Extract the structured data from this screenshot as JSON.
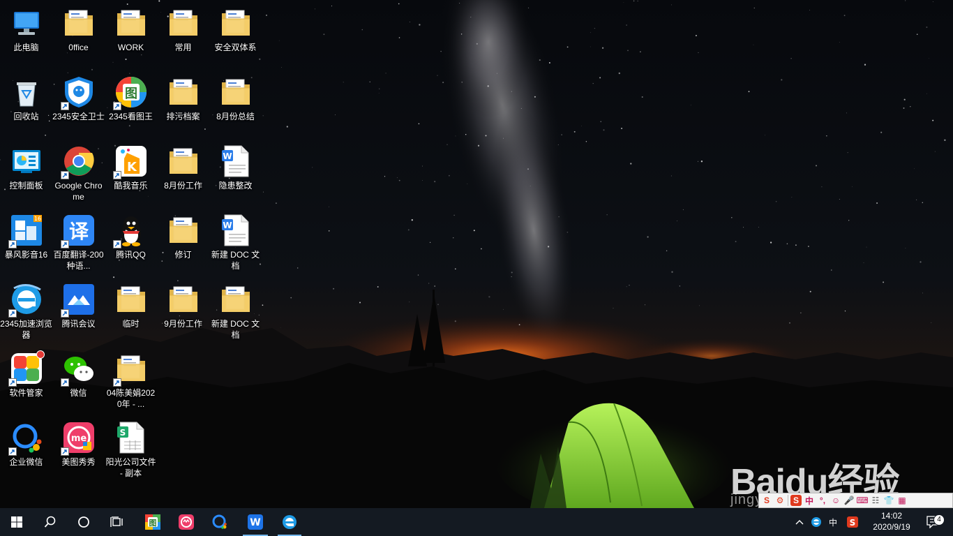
{
  "desktop": {
    "icons": [
      {
        "label": "此电脑",
        "icon": "computer-icon",
        "shortcut": false
      },
      {
        "label": "回收站",
        "icon": "recycle-bin-icon",
        "shortcut": false
      },
      {
        "label": "控制面板",
        "icon": "control-panel-icon",
        "shortcut": false
      },
      {
        "label": "暴风影音16",
        "icon": "baofeng-icon",
        "shortcut": true
      },
      {
        "label": "2345加速浏览器",
        "icon": "ie-browser-icon",
        "shortcut": true
      },
      {
        "label": "软件管家",
        "icon": "software-manager-icon",
        "shortcut": true
      },
      {
        "label": "企业微信",
        "icon": "wecom-icon",
        "shortcut": true
      },
      {
        "label": "0ffice",
        "icon": "folder-icon",
        "shortcut": false
      },
      {
        "label": "2345安全卫士",
        "icon": "shield-icon",
        "shortcut": true
      },
      {
        "label": "Google Chrome",
        "icon": "chrome-icon",
        "shortcut": true
      },
      {
        "label": "百度翻译-200种语...",
        "icon": "baidu-translate-icon",
        "shortcut": true
      },
      {
        "label": "腾讯会议",
        "icon": "tencent-meeting-icon",
        "shortcut": true
      },
      {
        "label": "微信",
        "icon": "wechat-icon",
        "shortcut": true
      },
      {
        "label": "美图秀秀",
        "icon": "meitu-icon",
        "shortcut": true
      },
      {
        "label": "WORK",
        "icon": "folder-icon",
        "shortcut": false
      },
      {
        "label": "2345看图王",
        "icon": "image-viewer-icon",
        "shortcut": true
      },
      {
        "label": "酷我音乐",
        "icon": "kuwo-music-icon",
        "shortcut": true
      },
      {
        "label": "腾讯QQ",
        "icon": "qq-penguin-icon",
        "shortcut": true
      },
      {
        "label": "临时",
        "icon": "folder-icon",
        "shortcut": false
      },
      {
        "label": "04陈美娟2020年 - ...",
        "icon": "folder-icon",
        "shortcut": true
      },
      {
        "label": "阳光公司文件 - 副本",
        "icon": "spreadsheet-icon",
        "shortcut": false
      },
      {
        "label": "常用",
        "icon": "folder-icon",
        "shortcut": false
      },
      {
        "label": "排污档案",
        "icon": "folder-icon",
        "shortcut": false
      },
      {
        "label": "8月份工作",
        "icon": "folder-icon",
        "shortcut": false
      },
      {
        "label": "修订",
        "icon": "folder-icon",
        "shortcut": false
      },
      {
        "label": "9月份工作",
        "icon": "folder-icon",
        "shortcut": false
      },
      {
        "label": "安全双体系",
        "icon": "folder-icon",
        "shortcut": false
      },
      {
        "label": "8月份总结",
        "icon": "folder-icon",
        "shortcut": false
      },
      {
        "label": "隐患整改",
        "icon": "word-doc-icon",
        "shortcut": false
      },
      {
        "label": "新建 DOC 文档",
        "icon": "word-doc-icon",
        "shortcut": false
      },
      {
        "label": "新建 DOC 文档",
        "icon": "folder-icon",
        "shortcut": false
      }
    ]
  },
  "watermark": {
    "logo": "Baidu经验",
    "url": "jingyan.baidu.com"
  },
  "ime_bar": {
    "mode": "中"
  },
  "taskbar": {
    "start": "windows-start-icon",
    "search": "search-icon",
    "cortana": "cortana-icon",
    "task_view": "task-view-icon",
    "pinned": [
      "image-viewer-icon",
      "meitu-icon",
      "wecom-icon",
      "wps-writer-icon",
      "ie-browser-icon"
    ],
    "tray": {
      "ime": "中",
      "show_hidden": "chevron-up-icon"
    },
    "clock": {
      "time": "14:02",
      "date": "2020/9/19"
    },
    "notifications": {
      "count": "4"
    }
  },
  "colors": {
    "taskbar": "#141a22",
    "accent": "#76b9ed",
    "folder": "#f5cf6b",
    "tent": "#8fdc3a",
    "horizon_glow": "#e0641b"
  }
}
